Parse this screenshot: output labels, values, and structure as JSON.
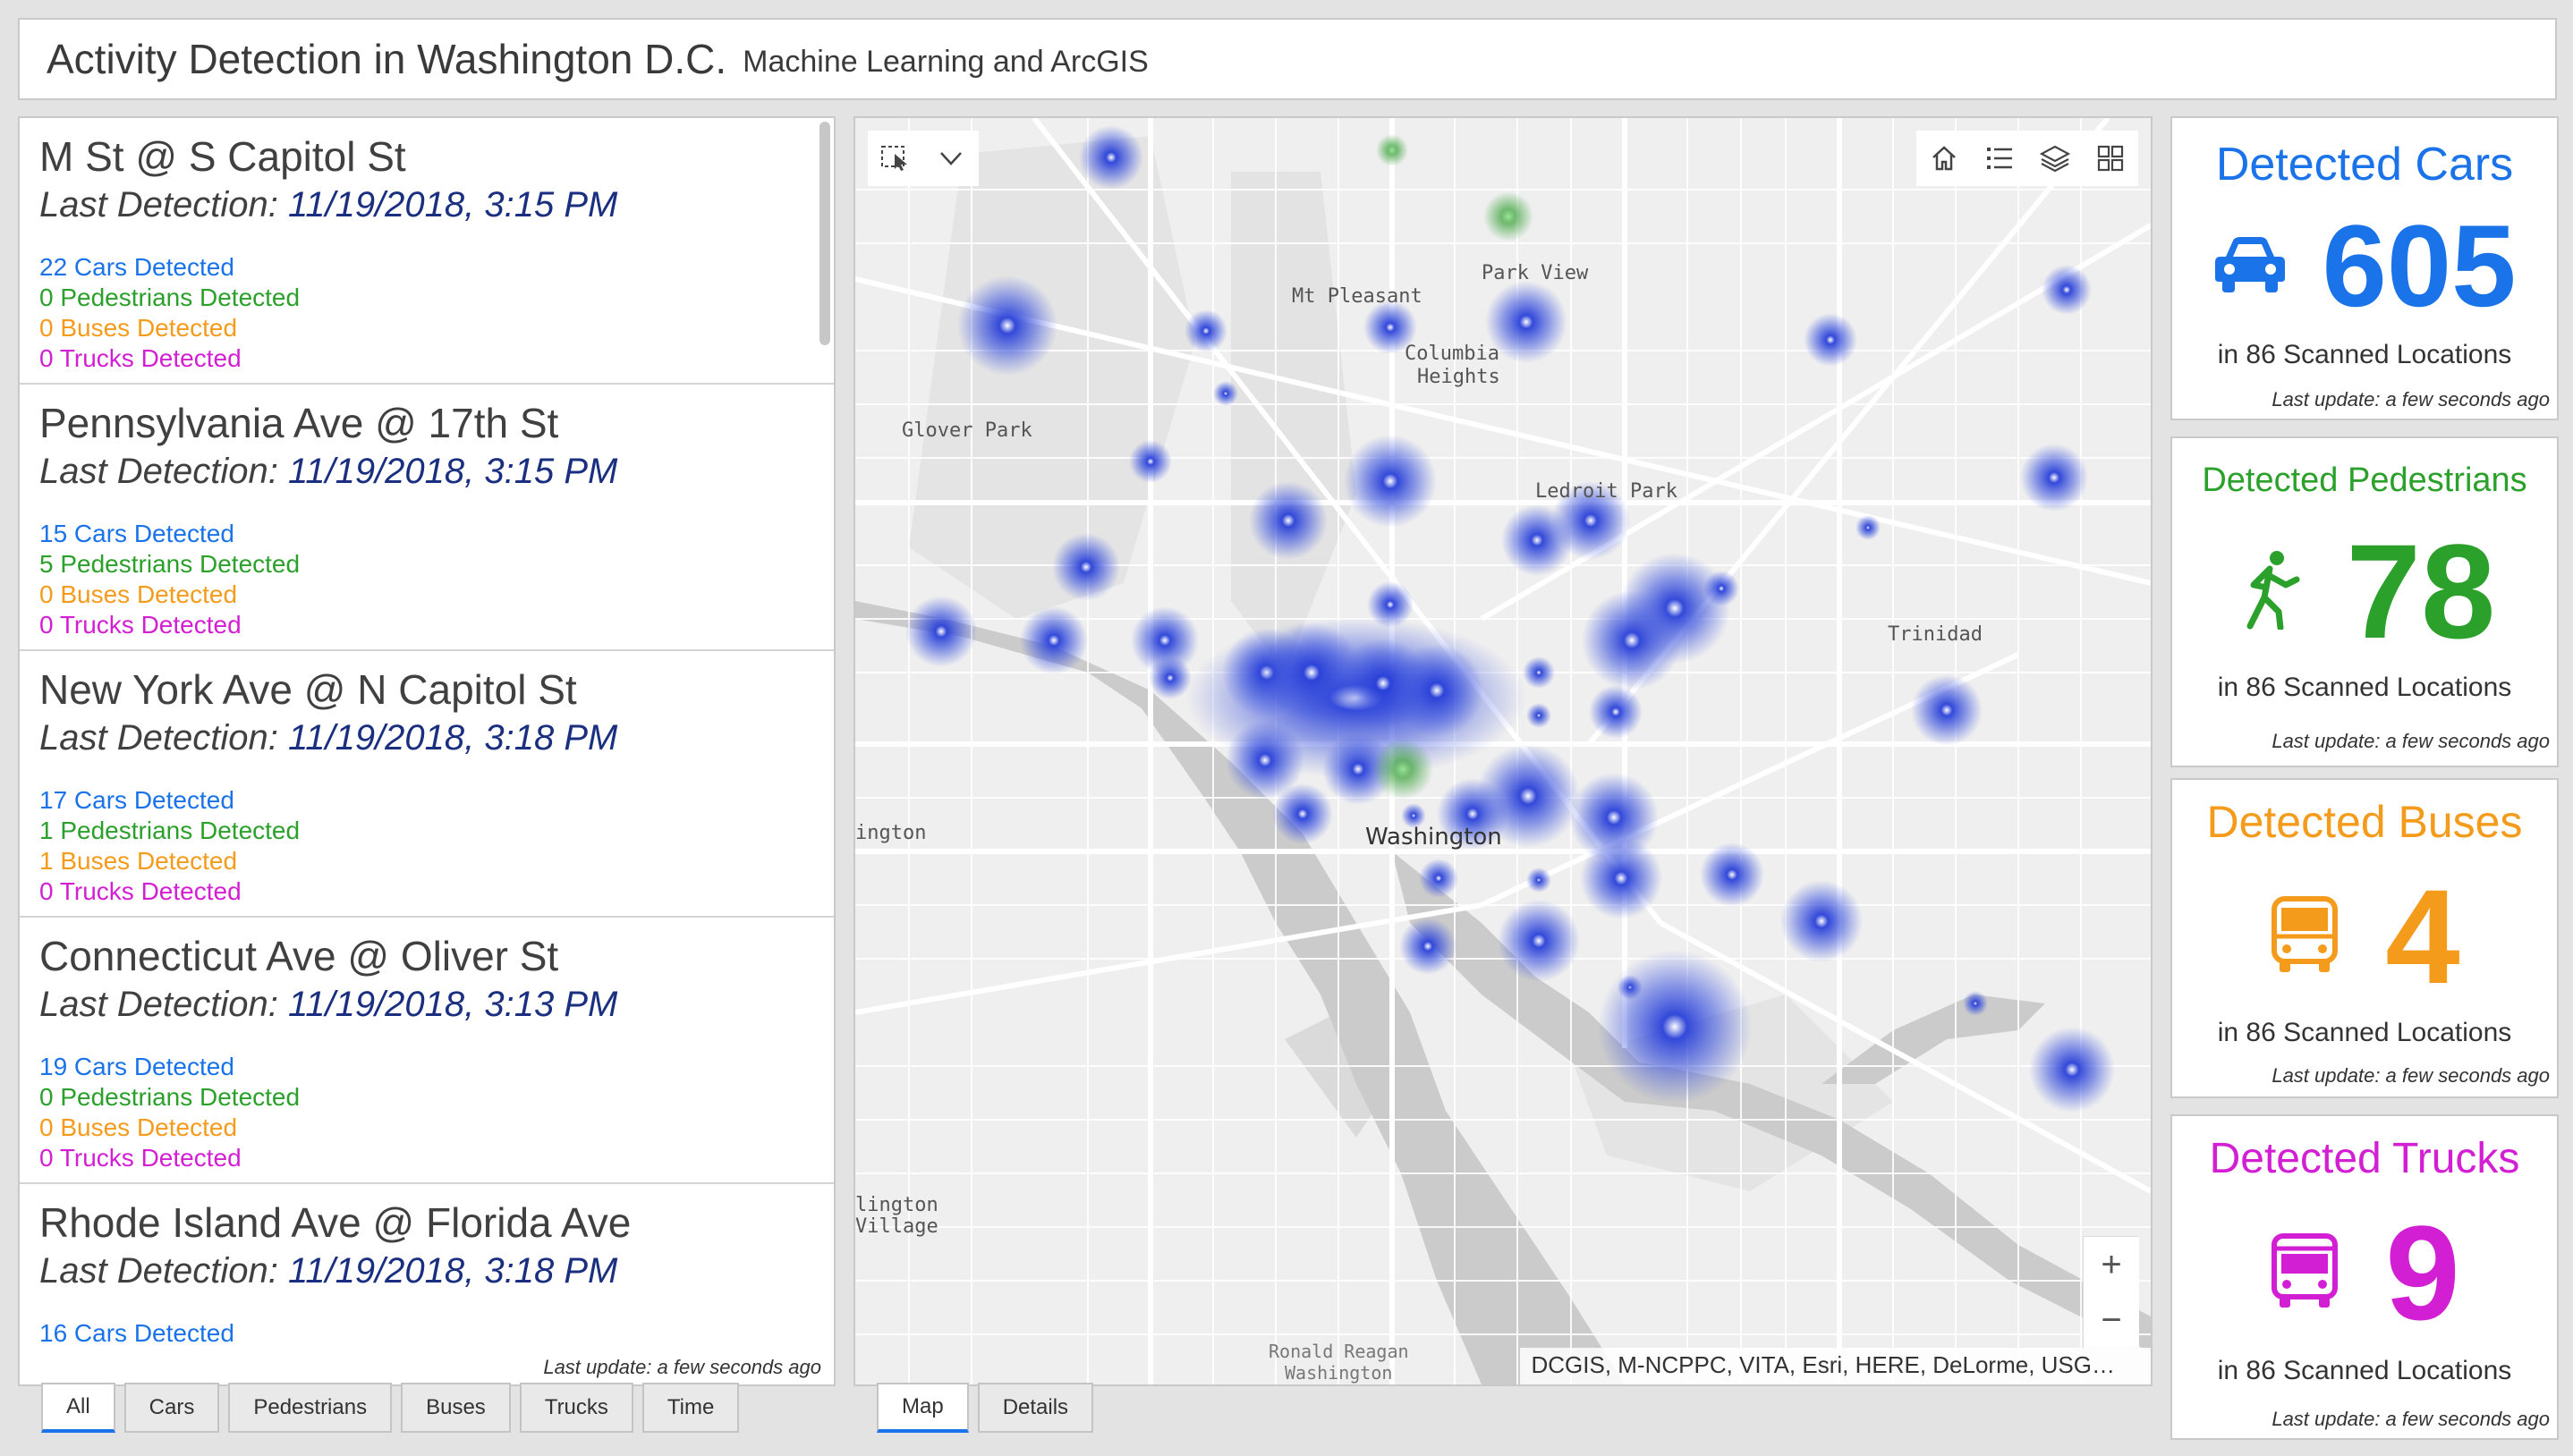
{
  "header": {
    "title": "Activity Detection in Washington D.C.",
    "subtitle": "Machine Learning and ArcGIS"
  },
  "locations": [
    {
      "name": "M St @ S Capitol St",
      "detection_label": "Last Detection: ",
      "detection_time": "11/19/2018, 3:15 PM",
      "cars": "22 Cars Detected",
      "pedestrians": "0 Pedestrians Detected",
      "buses": "0 Buses Detected",
      "trucks": "0 Trucks Detected"
    },
    {
      "name": "Pennsylvania Ave @ 17th St",
      "detection_label": "Last Detection: ",
      "detection_time": "11/19/2018, 3:15 PM",
      "cars": "15 Cars Detected",
      "pedestrians": "5 Pedestrians Detected",
      "buses": "0 Buses Detected",
      "trucks": "0 Trucks Detected"
    },
    {
      "name": "New York Ave @ N Capitol St",
      "detection_label": "Last Detection: ",
      "detection_time": "11/19/2018, 3:18 PM",
      "cars": "17 Cars Detected",
      "pedestrians": "1 Pedestrians Detected",
      "buses": "1 Buses Detected",
      "trucks": "0 Trucks Detected"
    },
    {
      "name": "Connecticut Ave @ Oliver St",
      "detection_label": "Last Detection: ",
      "detection_time": "11/19/2018, 3:13 PM",
      "cars": "19 Cars Detected",
      "pedestrians": "0 Pedestrians Detected",
      "buses": "0 Buses Detected",
      "trucks": "0 Trucks Detected"
    },
    {
      "name": "Rhode Island Ave @ Florida Ave",
      "detection_label": "Last Detection: ",
      "detection_time": "11/19/2018, 3:18 PM",
      "cars": "16 Cars Detected",
      "pedestrians": "",
      "buses": "",
      "trucks": ""
    }
  ],
  "list_last_update": "Last update: a few seconds ago",
  "list_tabs": [
    "All",
    "Cars",
    "Pedestrians",
    "Buses",
    "Trucks",
    "Time"
  ],
  "map_tabs": [
    "Map",
    "Details"
  ],
  "map": {
    "labels": {
      "mt_pleasant": "Mt Pleasant",
      "park_view": "Park View",
      "columbia_heights": "Columbia\nHeights",
      "glover_park": "Glover Park",
      "ledroit_park": "Ledroit Park",
      "trinidad": "Trinidad",
      "washington": "Washington",
      "ington": "ington",
      "arlington_village": "lington\nVillage",
      "ronald_reagan": "Ronald Reagan\nWashington"
    },
    "toolbar_left_icons": [
      "select-icon",
      "dropdown-icon"
    ],
    "toolbar_right_icons": [
      "home-icon",
      "legend-icon",
      "layers-icon",
      "basemap-gallery-icon"
    ],
    "zoom_in": "+",
    "zoom_out": "−",
    "attribution": "DCGIS, M-NCPPC, VITA, Esri, HERE, DeLorme, USG…"
  },
  "stats": [
    {
      "title": "Detected Cars",
      "value": "605",
      "scanned": "in 86 Scanned Locations",
      "update": "Last update: a few seconds ago",
      "color": "#1a73e8",
      "icon": "car-icon"
    },
    {
      "title": "Detected Pedestrians",
      "value": "78",
      "scanned": "in 86 Scanned Locations",
      "update": "Last update: a few seconds ago",
      "color": "#2ba02b",
      "icon": "pedestrian-icon"
    },
    {
      "title": "Detected Buses",
      "value": "4",
      "scanned": "in 86 Scanned Locations",
      "update": "Last update: a few seconds ago",
      "color": "#f59b1c",
      "icon": "bus-icon"
    },
    {
      "title": "Detected Trucks",
      "value": "9",
      "scanned": "in 86 Scanned Locations",
      "update": "Last update: a few seconds ago",
      "color": "#d31fd3",
      "icon": "truck-icon"
    }
  ]
}
